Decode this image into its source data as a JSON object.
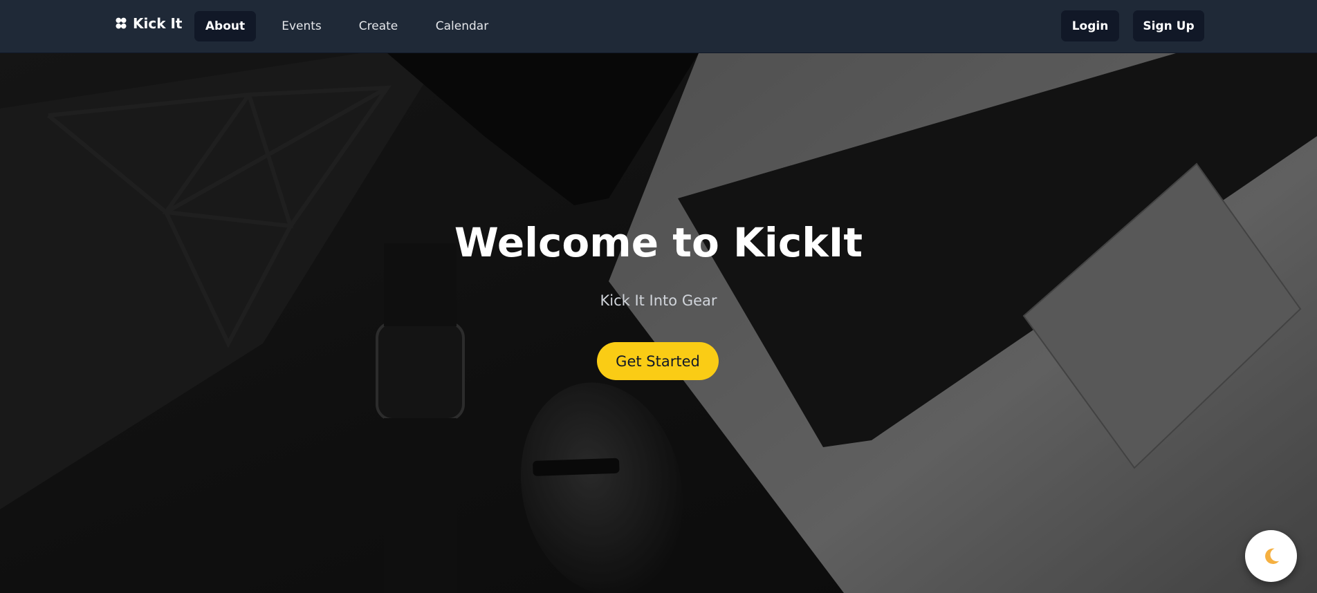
{
  "brand": {
    "name": "Kick It",
    "icon": "flower-logo-icon"
  },
  "nav": {
    "items": [
      {
        "label": "About",
        "active": true
      },
      {
        "label": "Events",
        "active": false
      },
      {
        "label": "Create",
        "active": false
      },
      {
        "label": "Calendar",
        "active": false
      }
    ]
  },
  "auth": {
    "login_label": "Login",
    "signup_label": "Sign Up"
  },
  "hero": {
    "title": "Welcome to KickIt",
    "subtitle": "Kick It Into Gear",
    "cta_label": "Get Started",
    "background": "laptop-desk-photo"
  },
  "theme_toggle": {
    "icon": "moon-icon"
  },
  "colors": {
    "navbar": "#1f2937",
    "active_nav": "#111827",
    "cta": "#facc15",
    "text": "#ffffff"
  }
}
